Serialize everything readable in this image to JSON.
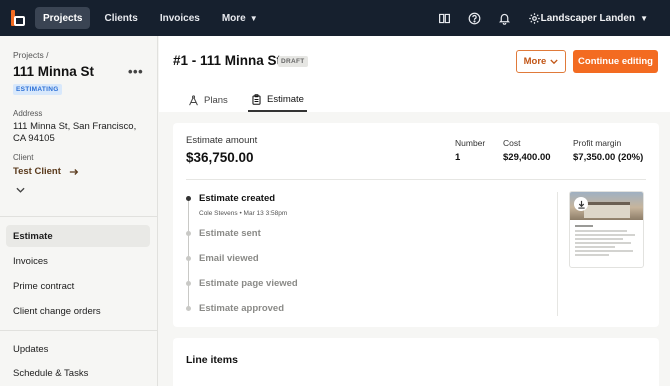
{
  "nav": {
    "items": [
      {
        "label": "Projects",
        "active": true
      },
      {
        "label": "Clients",
        "active": false
      },
      {
        "label": "Invoices",
        "active": false
      },
      {
        "label": "More",
        "active": false
      }
    ],
    "icons": [
      "book-icon",
      "help-icon",
      "bell-icon",
      "gear-icon"
    ],
    "user": "Landscaper Landen"
  },
  "sidebar": {
    "breadcrumb": "Projects /",
    "title": "111 Minna St",
    "more": "•••",
    "status": "ESTIMATING",
    "address_label": "Address",
    "address_line1": "111 Minna St, San Francisco,",
    "address_line2": "CA 94105",
    "client_label": "Client",
    "client_name": "Test Client",
    "items": [
      {
        "label": "Estimate",
        "active": true
      },
      {
        "label": "Invoices",
        "active": false
      },
      {
        "label": "Prime contract",
        "active": false
      },
      {
        "label": "Client change orders",
        "active": false
      },
      {
        "label": "Updates",
        "active": false
      },
      {
        "label": "Schedule & Tasks",
        "active": false
      }
    ]
  },
  "main": {
    "title": "#1 - 111 Minna St",
    "status": "DRAFT",
    "more_label": "More",
    "continue_label": "Continue editing",
    "tabs": [
      {
        "label": "Plans",
        "active": false
      },
      {
        "label": "Estimate",
        "active": true
      }
    ],
    "estimate": {
      "amount_label": "Estimate amount",
      "amount": "$36,750.00",
      "number_label": "Number",
      "number": "1",
      "cost_label": "Cost",
      "cost": "$29,400.00",
      "margin_label": "Profit margin",
      "margin": "$7,350.00 (20%)"
    },
    "timeline": [
      {
        "label": "Estimate created",
        "done": true,
        "sub": "Cole Stevens • Mar 13 3:58pm"
      },
      {
        "label": "Estimate sent",
        "done": false
      },
      {
        "label": "Email viewed",
        "done": false
      },
      {
        "label": "Estimate page viewed",
        "done": false
      },
      {
        "label": "Estimate approved",
        "done": false
      }
    ],
    "line_items_title": "Line items"
  },
  "colors": {
    "nav_bg": "#16202e",
    "accent": "#f36b21",
    "badge_blue": "#2b6fd6"
  }
}
